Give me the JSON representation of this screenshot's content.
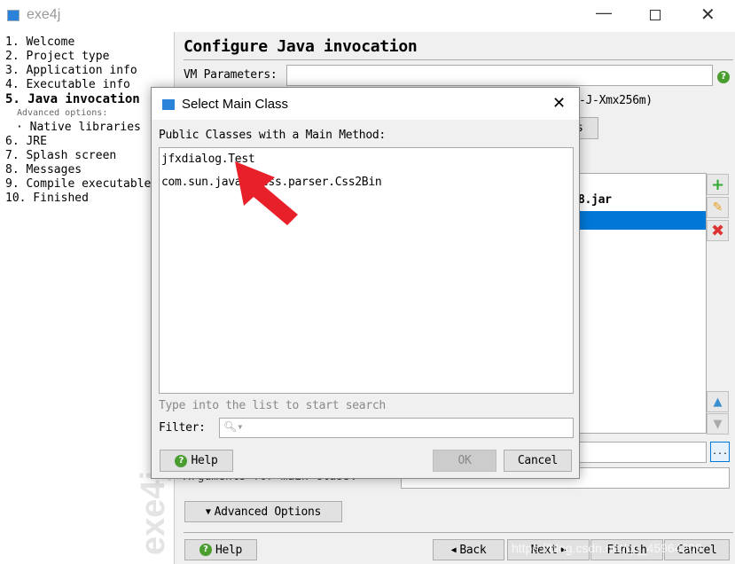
{
  "window": {
    "title": "exe4j",
    "controls": [
      "minimize",
      "maximize",
      "close"
    ]
  },
  "steps": [
    {
      "label": "1. Welcome"
    },
    {
      "label": "2. Project type"
    },
    {
      "label": "3. Application info"
    },
    {
      "label": "4. Executable info"
    },
    {
      "label": "5. Java invocation",
      "active": true
    },
    {
      "label": "Advanced options:"
    },
    {
      "label": "· Native libraries"
    },
    {
      "label": "6. JRE"
    },
    {
      "label": "7. Splash screen"
    },
    {
      "label": "8. Messages"
    },
    {
      "label": "9. Compile executable"
    },
    {
      "label": "10. Finished"
    }
  ],
  "main": {
    "title": "Configure Java invocation",
    "vm_label": "VM Parameters:",
    "vm_value": "",
    "vm_hint": "-J-Xmx256m)",
    "partial_button": "s",
    "classpath_item": "8.jar",
    "args_label": "Arguments for main class:",
    "advanced_label": "Advanced Options",
    "help": "Help",
    "back": "Back",
    "next": "Next",
    "finish": "Finish",
    "cancel": "Cancel",
    "browse": "...",
    "watermark": "exe4j",
    "url_watermark": "https://blog.csdn.net/qq_45964209"
  },
  "dialog": {
    "title": "Select Main Class",
    "list_label": "Public Classes with a Main Method:",
    "classes": [
      "jfxdialog.Test",
      "com.sun.javafx.css.parser.Css2Bin"
    ],
    "hint": "Type into the list to start search",
    "filter_label": "Filter:",
    "filter_value": "",
    "help": "Help",
    "ok": "OK",
    "cancel": "Cancel"
  },
  "colors": {
    "accent": "#0078d7",
    "help": "#4a9d2f",
    "arrow": "#e8202a"
  }
}
